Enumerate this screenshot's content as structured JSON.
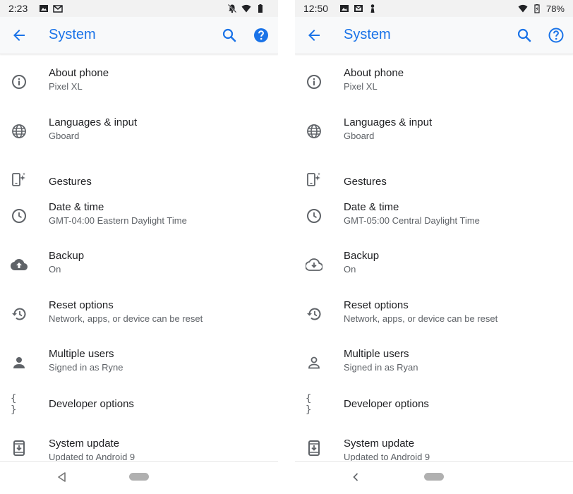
{
  "screens": [
    {
      "status": {
        "time": "2:23",
        "battery": ""
      },
      "app_bar": {
        "title": "System"
      },
      "items": [
        {
          "title": "About phone",
          "summary": "Pixel XL"
        },
        {
          "title": "Languages & input",
          "summary": "Gboard"
        },
        {
          "title": "Gestures",
          "summary": ""
        },
        {
          "title": "Date & time",
          "summary": "GMT-04:00 Eastern Daylight Time"
        },
        {
          "title": "Backup",
          "summary": "On"
        },
        {
          "title": "Reset options",
          "summary": "Network, apps, or device can be reset"
        },
        {
          "title": "Multiple users",
          "summary": "Signed in as Ryne"
        },
        {
          "title": "Developer options",
          "summary": ""
        },
        {
          "title": "System update",
          "summary": "Updated to Android 9"
        }
      ]
    },
    {
      "status": {
        "time": "12:50",
        "battery": "78%"
      },
      "app_bar": {
        "title": "System"
      },
      "items": [
        {
          "title": "About phone",
          "summary": "Pixel XL"
        },
        {
          "title": "Languages & input",
          "summary": "Gboard"
        },
        {
          "title": "Gestures",
          "summary": ""
        },
        {
          "title": "Date & time",
          "summary": "GMT-05:00 Central Daylight Time"
        },
        {
          "title": "Backup",
          "summary": "On"
        },
        {
          "title": "Reset options",
          "summary": "Network, apps, or device can be reset"
        },
        {
          "title": "Multiple users",
          "summary": "Signed in as Ryan"
        },
        {
          "title": "Developer options",
          "summary": ""
        },
        {
          "title": "System update",
          "summary": "Updated to Android 9"
        }
      ]
    }
  ],
  "icons": [
    "info-icon",
    "globe-icon",
    "gestures-icon",
    "clock-icon",
    "cloud-upload-icon",
    "history-icon",
    "person-icon",
    "braces-icon",
    "system-update-icon"
  ],
  "colors": {
    "accent": "#1a73e8",
    "icon": "#5f6368",
    "text": "#202124",
    "summary": "#5f6368"
  }
}
